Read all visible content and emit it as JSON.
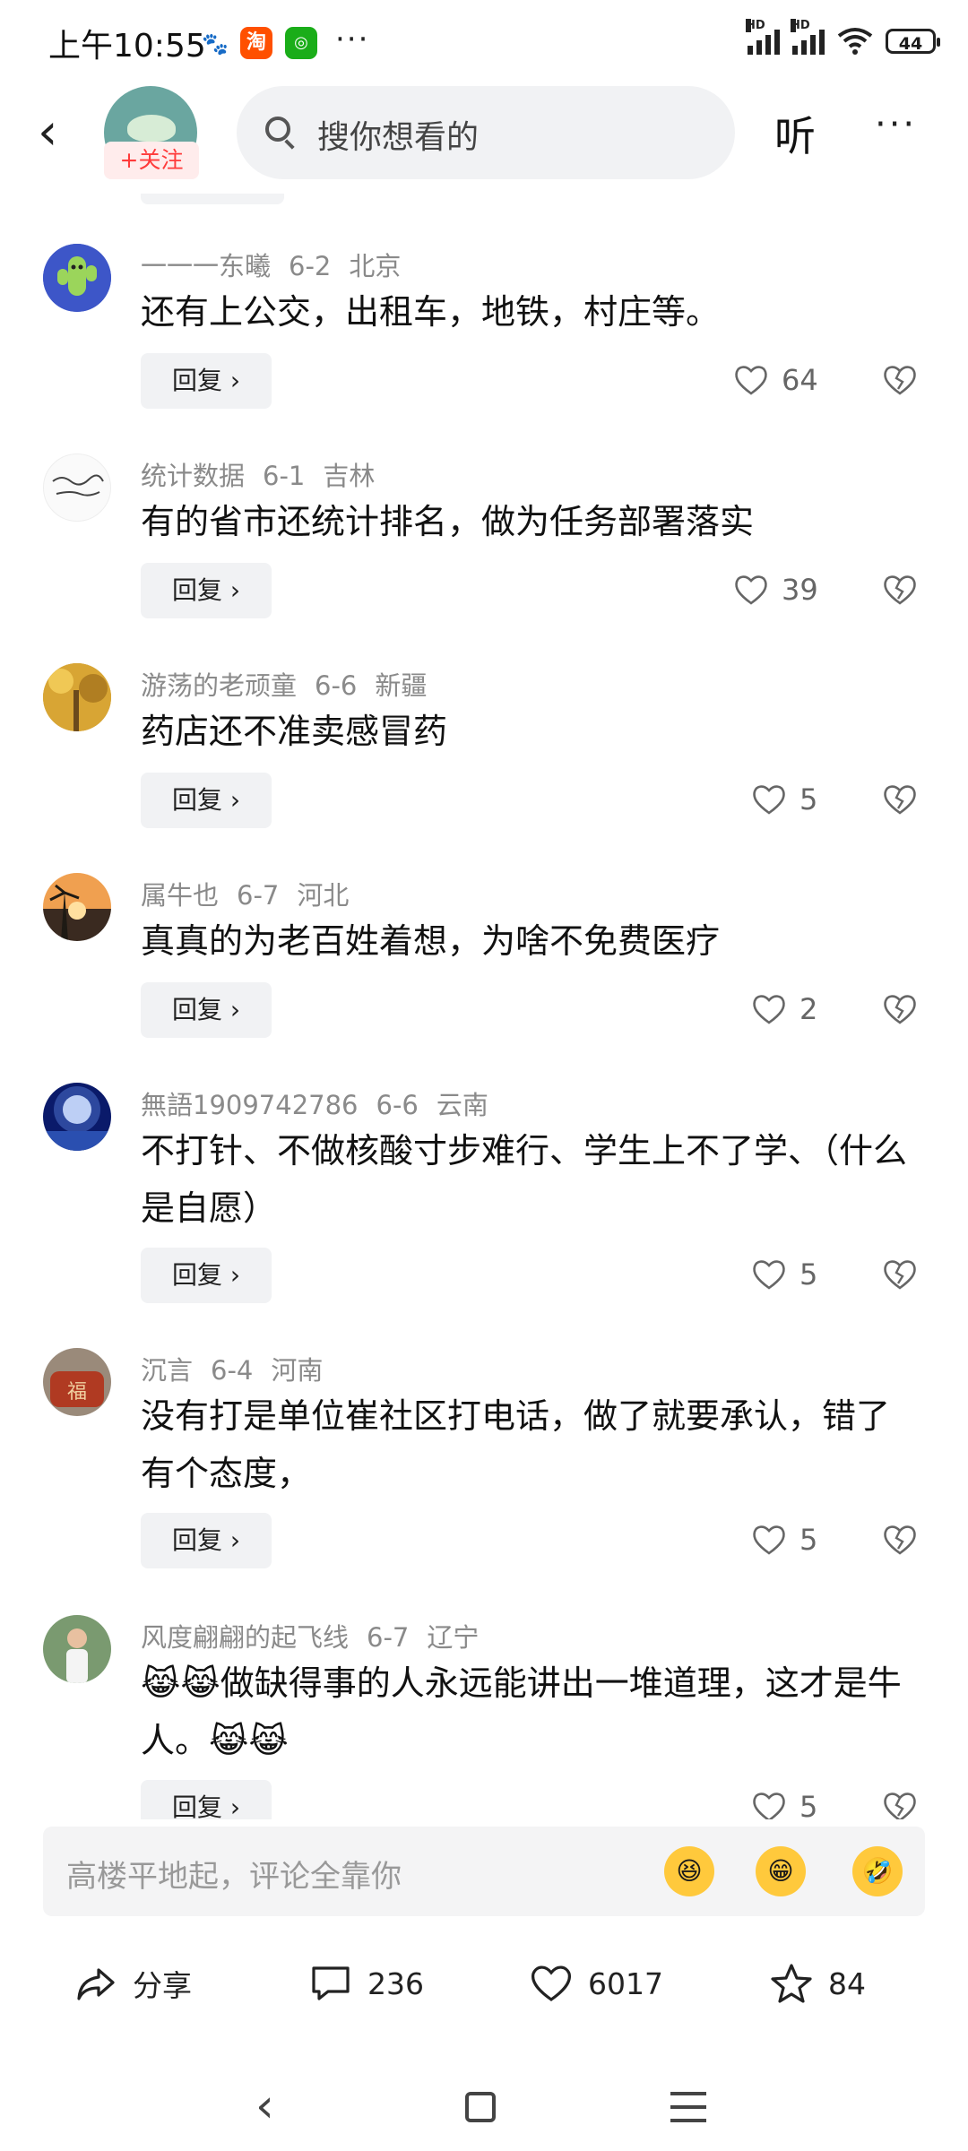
{
  "status_bar": {
    "time": "上午10:55",
    "battery": "44",
    "hd_label": "HD"
  },
  "header": {
    "follow_label": "+关注",
    "search_placeholder": "搜你想看的",
    "listen_label": "听"
  },
  "comments": [
    {
      "user": "一一一东曦",
      "date": "6-2",
      "location": "北京",
      "text": "还有上公交，出租车，地铁，村庄等。",
      "reply": "回复 ›",
      "likes": "64"
    },
    {
      "user": "统计数据",
      "date": "6-1",
      "location": "吉林",
      "text": "有的省市还统计排名，做为任务部署落实",
      "reply": "回复 ›",
      "likes": "39"
    },
    {
      "user": "游荡的老顽童",
      "date": "6-6",
      "location": "新疆",
      "text": "药店还不准卖感冒药",
      "reply": "回复 ›",
      "likes": "5"
    },
    {
      "user": "属牛也",
      "date": "6-7",
      "location": "河北",
      "text": "真真的为老百姓着想，为啥不免费医疗",
      "reply": "回复 ›",
      "likes": "2"
    },
    {
      "user": "無語1909742786",
      "date": "6-6",
      "location": "云南",
      "text": "不打针、不做核酸寸步难行、学生上不了学、（什么是自愿）",
      "reply": "回复 ›",
      "likes": "5"
    },
    {
      "user": "沉言",
      "date": "6-4",
      "location": "河南",
      "text": "没有打是单位崔社区打电话，做了就要承认，错了有个态度，",
      "reply": "回复 ›",
      "likes": "5"
    },
    {
      "user": "风度翩翩的起飞线",
      "date": "6-7",
      "location": "辽宁",
      "text": "😹😹做缺得事的人永远能讲出一堆道理，这才是牛人。😹😹",
      "reply": "回复 ›",
      "likes": "5"
    }
  ],
  "comment_input": {
    "placeholder": "高楼平地起，评论全靠你"
  },
  "actions": {
    "share_label": "分享",
    "comment_count": "236",
    "like_count": "6017",
    "favorite_count": "84"
  },
  "colors": {
    "follow_red": "#ff3b3b",
    "meta_gray": "#8a8a8a",
    "chip_bg": "#f1f2f4"
  }
}
